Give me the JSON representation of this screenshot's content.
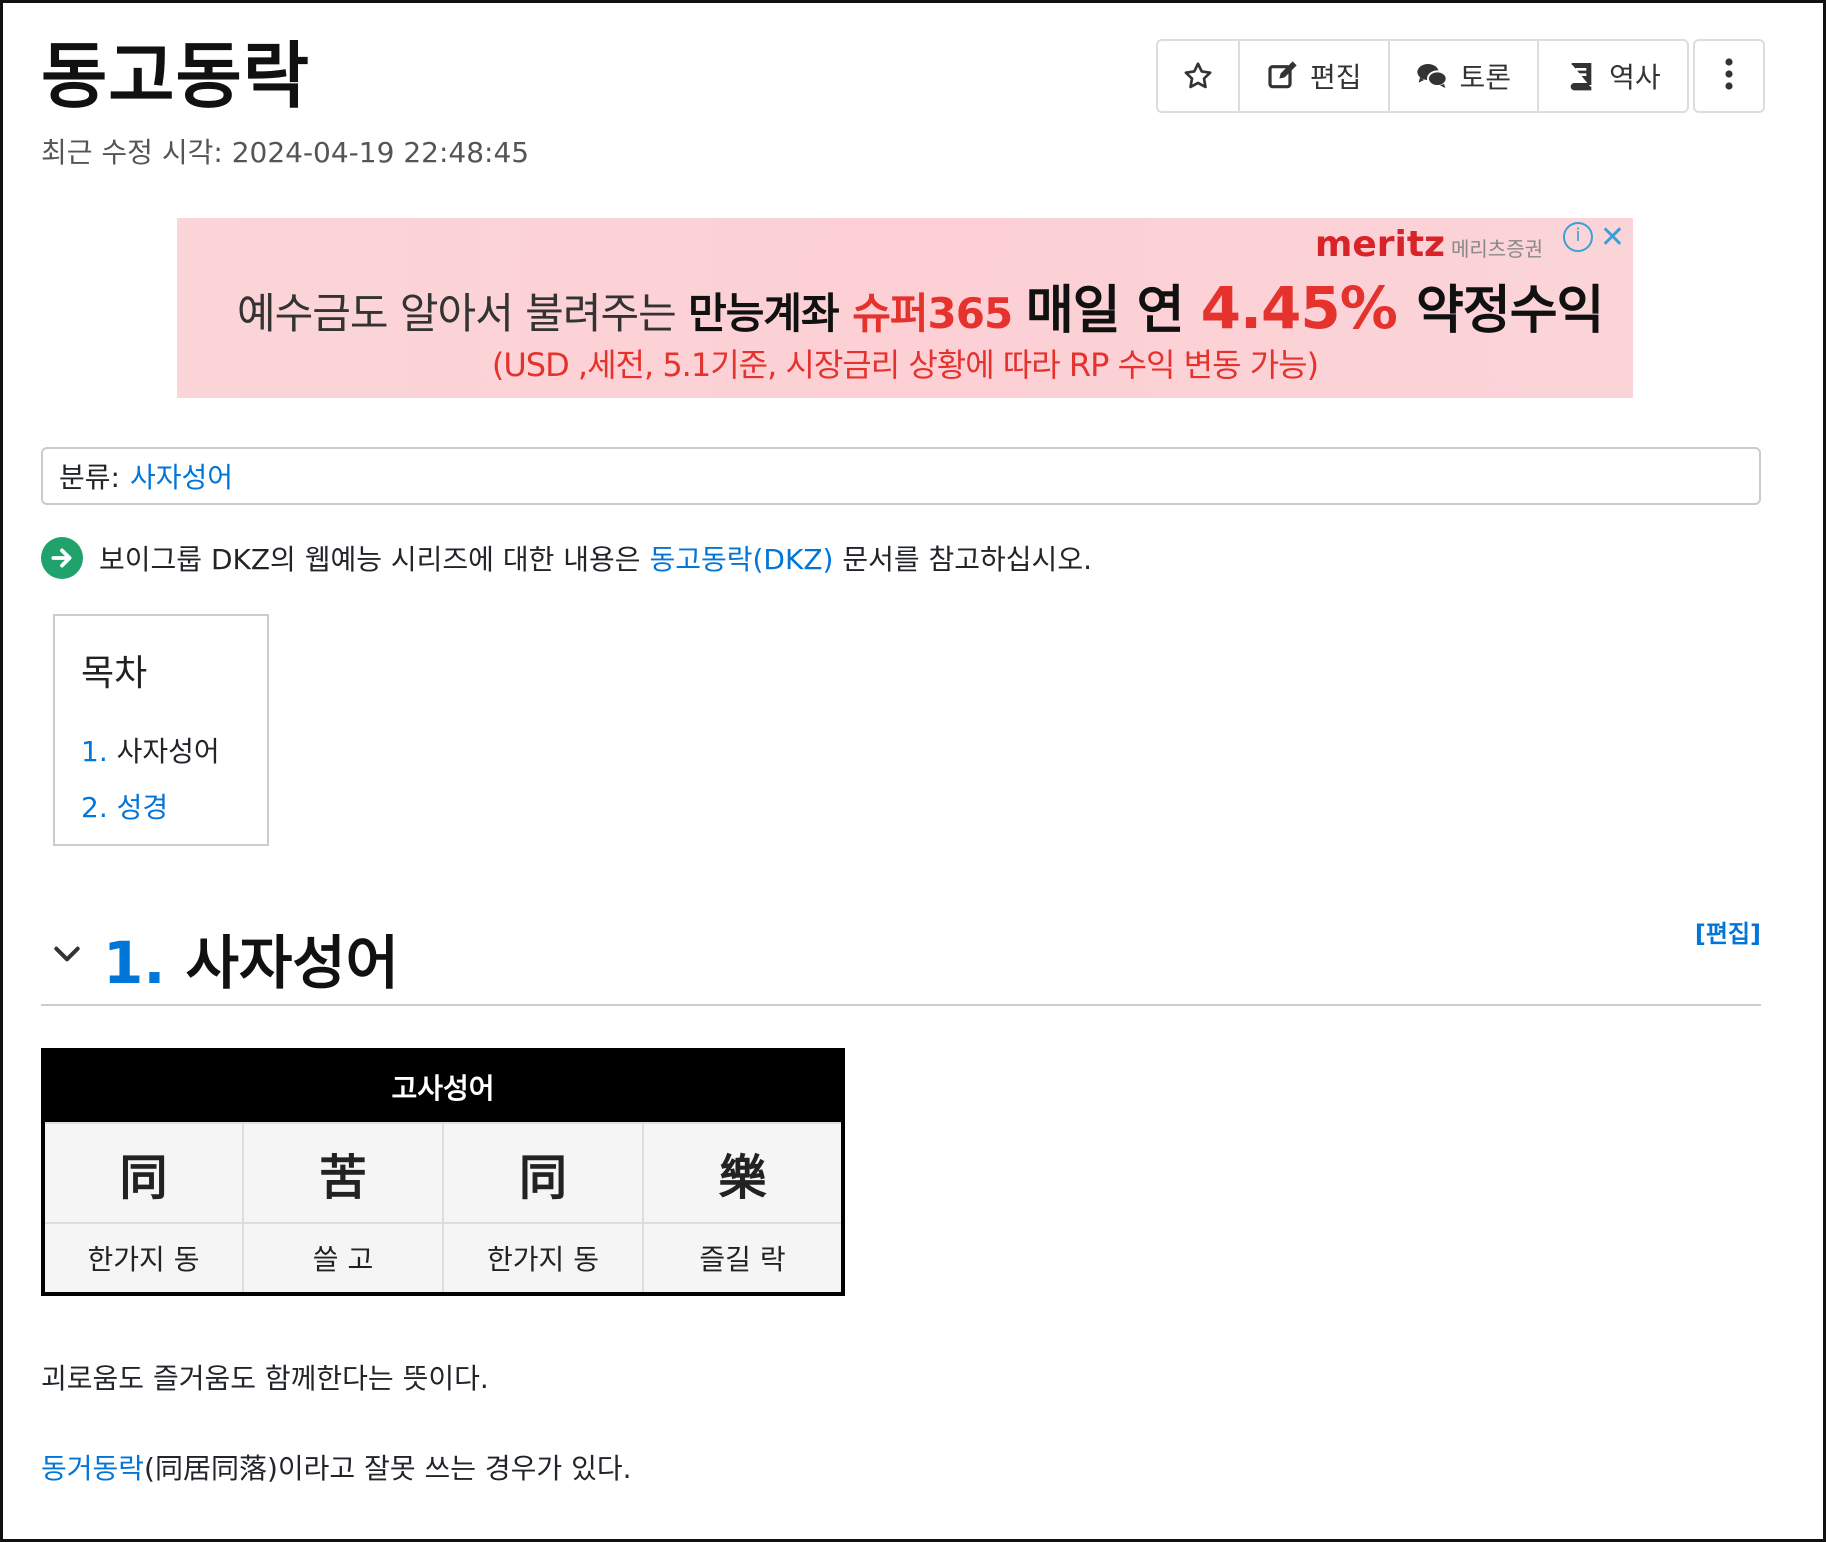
{
  "title": "동고동락",
  "last_modified": "최근 수정 시각: 2024-04-19 22:48:45",
  "toolbar": {
    "edit_label": "편집",
    "discuss_label": "토론",
    "history_label": "역사"
  },
  "ad": {
    "brand": "meritz",
    "brand_sub": "메리츠증권",
    "line1_part1": "예수금도 알아서 불려주는 ",
    "line1_part2": "만능계좌 ",
    "line1_part3": "슈퍼365 ",
    "line1_part4": "매일 연 ",
    "line1_part5": "4.45% ",
    "line1_part6": "약정수익",
    "line2": "(USD ,세전, 5.1기준, 시장금리 상황에 따라 RP 수익 변동 가능)"
  },
  "category": {
    "label": "분류:",
    "value": "사자성어"
  },
  "note": {
    "before": "보이그룹 DKZ의 웹예능 시리즈에 대한 내용은 ",
    "link": "동고동락(DKZ)",
    "after": " 문서를 참고하십시오."
  },
  "toc": {
    "title": "목차",
    "items": [
      {
        "num": "1.",
        "label": "사자성어"
      },
      {
        "num": "2.",
        "label": "성경"
      }
    ]
  },
  "section": {
    "num": "1.",
    "title": "사자성어",
    "edit": "[편집]"
  },
  "idiom_table": {
    "header": "고사성어",
    "hanja": [
      "同",
      "苦",
      "同",
      "樂"
    ],
    "hun": [
      "한가지 동",
      "쓸 고",
      "한가지 동",
      "즐길 락"
    ]
  },
  "paragraphs": {
    "p1": "괴로움도 즐거움도 함께한다는 뜻이다.",
    "p2_link": "동거동락",
    "p2_rest": "(同居同落)이라고 잘못 쓰는 경우가 있다."
  }
}
